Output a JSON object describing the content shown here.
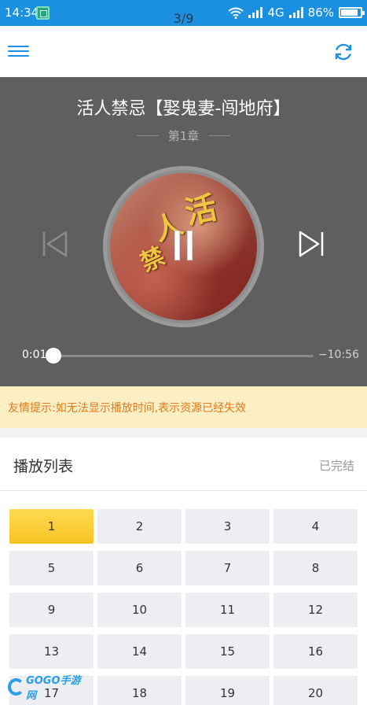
{
  "status_bar": {
    "time": "14:34",
    "page_indicator": "3/9",
    "network": "4G",
    "battery": "86%",
    "battery_level": 0.86
  },
  "topbar": {
    "menu_icon": "menu-icon",
    "refresh_icon": "refresh-icon"
  },
  "player": {
    "title": "活人禁忌【娶鬼妻-闯地府】",
    "chapter": "第1章",
    "cover_text": [
      "活",
      "人",
      "禁"
    ],
    "current_time": "0:01",
    "remaining_time": "−10:56",
    "progress": 0.0,
    "prev_icon": "skip-previous-icon",
    "next_icon": "skip-next-icon",
    "pause_icon": "pause-icon"
  },
  "notice": {
    "text": "友情提示:如无法显示播放时间,表示资源已经失效"
  },
  "playlist": {
    "title": "播放列表",
    "status": "已完结",
    "active_index": 0,
    "episodes": [
      "1",
      "2",
      "3",
      "4",
      "5",
      "6",
      "7",
      "8",
      "9",
      "10",
      "11",
      "12",
      "13",
      "14",
      "15",
      "16",
      "17",
      "18",
      "19",
      "20"
    ]
  },
  "watermark": {
    "text": "GOGO手游网"
  },
  "colors": {
    "accent": "#1b8fe0",
    "player_bg": "#5f5f5f",
    "notice_bg": "#fdefc4",
    "notice_text": "#e27a1e",
    "active_episode": "#f9cc33"
  }
}
